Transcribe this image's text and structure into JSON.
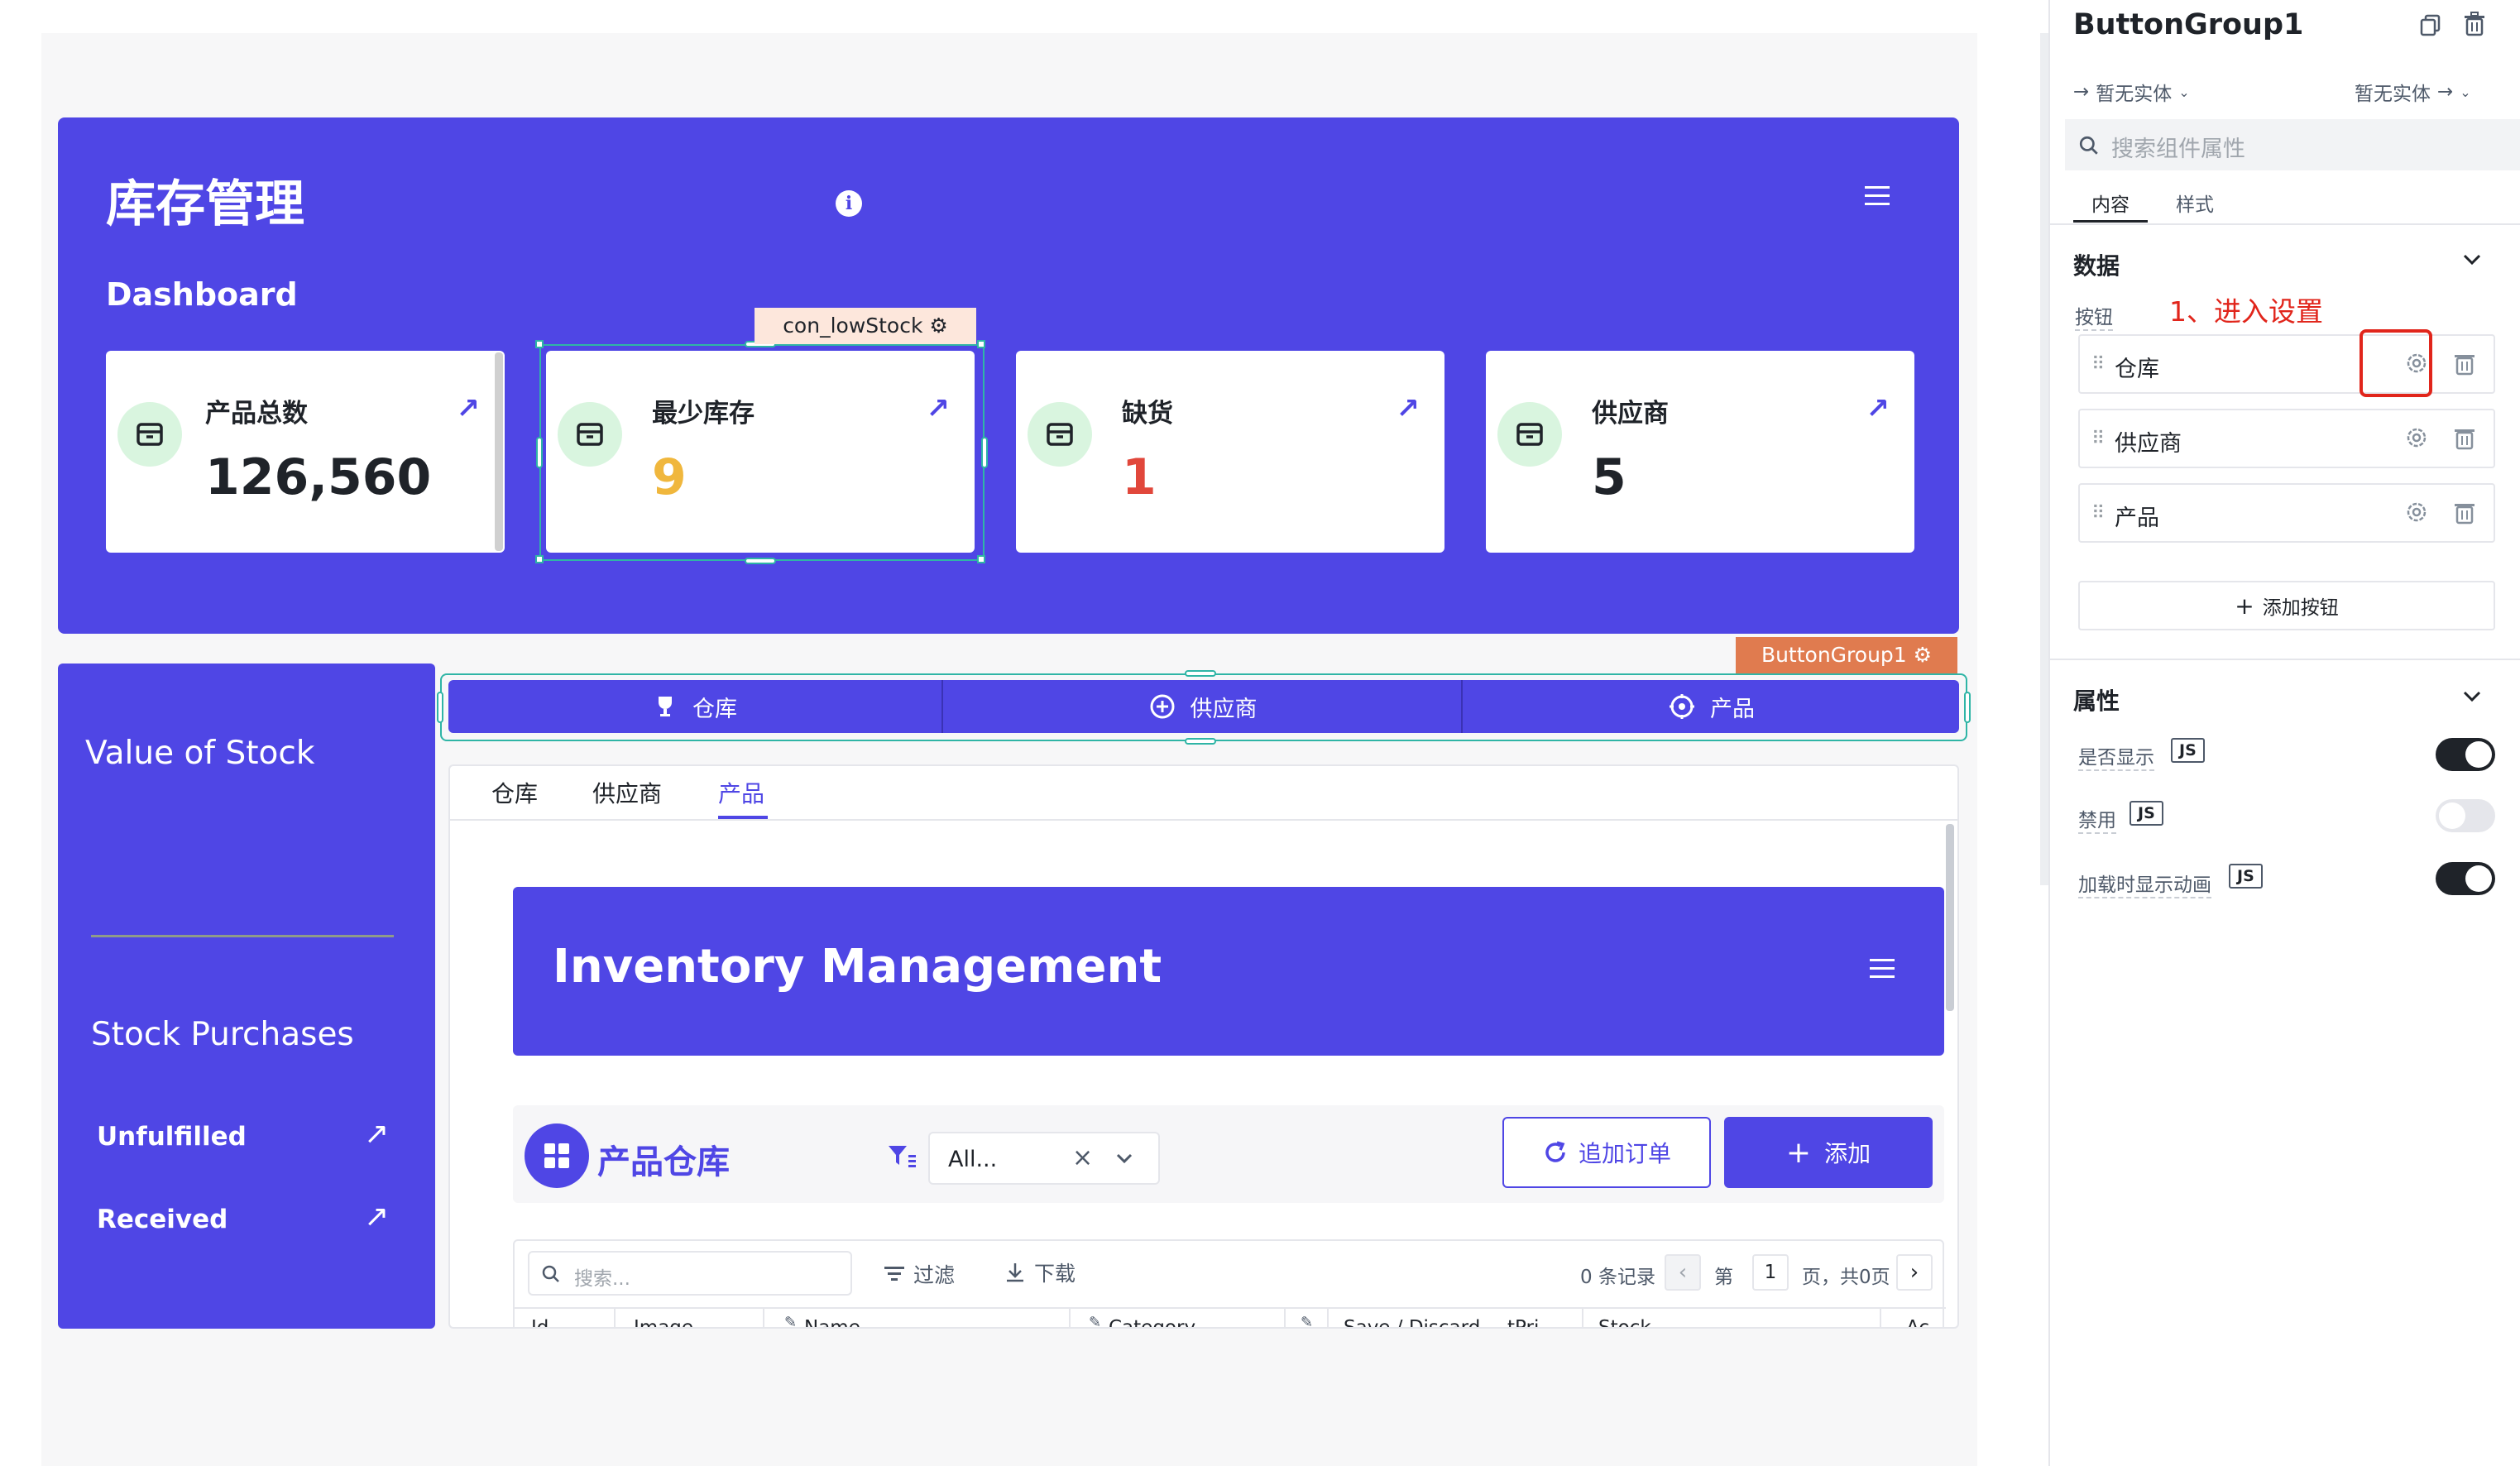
{
  "header": {
    "title": "库存管理",
    "section_title": "Dashboard",
    "info_icon": "info-icon",
    "menu_icon": "hamburger-menu-icon"
  },
  "stats": [
    {
      "label": "产品总数",
      "value": "126,560",
      "value_color": "#1f2329"
    },
    {
      "label": "最少库存",
      "value": "9",
      "value_color": "#f0b73d"
    },
    {
      "label": "缺货",
      "value": "1",
      "value_color": "#e1473b"
    },
    {
      "label": "供应商",
      "value": "5",
      "value_color": "#1f2329"
    }
  ],
  "selection_tags": {
    "low_stock": "con_lowStock ⚙",
    "button_group": "ButtonGroup1 ⚙"
  },
  "sidebar": {
    "value_of_stock": "Value of Stock",
    "stock_purchases": "Stock Purchases",
    "links": [
      {
        "label": "Unfulfilled"
      },
      {
        "label": "Received"
      }
    ]
  },
  "button_group": [
    {
      "label": "仓库",
      "icon": "trophy-icon"
    },
    {
      "label": "供应商",
      "icon": "plus-circle-icon"
    },
    {
      "label": "产品",
      "icon": "target-icon"
    }
  ],
  "tabs": [
    {
      "label": "仓库"
    },
    {
      "label": "供应商"
    },
    {
      "label": "产品"
    }
  ],
  "inner": {
    "banner_title": "Inventory Management",
    "panel_title": "产品仓库",
    "filter_value": "All...",
    "reorder_button": "追加订单",
    "add_button": "添加"
  },
  "table": {
    "search_placeholder": "搜索...",
    "filter_label": "过滤",
    "download_label": "下载",
    "record_count": "0 条记录",
    "page_prefix": "第",
    "page_number": "1",
    "page_suffix": "页，共0页",
    "columns": [
      "Id",
      "Image",
      "Name",
      "Category",
      "Save / Discard",
      "tPri",
      "Stock",
      "Ac"
    ]
  },
  "inspector": {
    "title": "ButtonGroup1",
    "entity_left": "暂无实体",
    "entity_right": "暂无实体",
    "search_placeholder": "搜索组件属性",
    "tabs": [
      "内容",
      "样式"
    ],
    "data_section": "数据",
    "buttons_label": "按钮",
    "annotation": "1、进入设置",
    "annotation_color": "#e1251b",
    "button_items": [
      "仓库",
      "供应商",
      "产品"
    ],
    "add_button": "添加按钮",
    "props_section": "属性",
    "props": [
      {
        "label": "是否显示",
        "js": "JS",
        "on": true
      },
      {
        "label": "禁用",
        "js": "JS",
        "on": false
      },
      {
        "label": "加载时显示动画",
        "js": "JS",
        "on": true
      }
    ]
  },
  "colors": {
    "accent": "#4f46e5",
    "selection": "#2fb5a6",
    "tag_bg": "#e07b4f"
  }
}
